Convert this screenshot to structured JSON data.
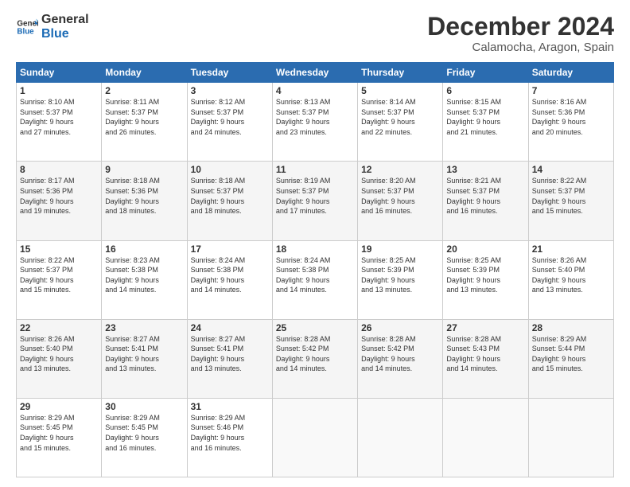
{
  "logo": {
    "line1": "General",
    "line2": "Blue"
  },
  "title": "December 2024",
  "location": "Calamocha, Aragon, Spain",
  "days_header": [
    "Sunday",
    "Monday",
    "Tuesday",
    "Wednesday",
    "Thursday",
    "Friday",
    "Saturday"
  ],
  "weeks": [
    [
      {
        "num": "1",
        "rise": "8:10 AM",
        "set": "5:37 PM",
        "hours": "9",
        "mins": "27"
      },
      {
        "num": "2",
        "rise": "8:11 AM",
        "set": "5:37 PM",
        "hours": "9",
        "mins": "26"
      },
      {
        "num": "3",
        "rise": "8:12 AM",
        "set": "5:37 PM",
        "hours": "9",
        "mins": "24"
      },
      {
        "num": "4",
        "rise": "8:13 AM",
        "set": "5:37 PM",
        "hours": "9",
        "mins": "23"
      },
      {
        "num": "5",
        "rise": "8:14 AM",
        "set": "5:37 PM",
        "hours": "9",
        "mins": "22"
      },
      {
        "num": "6",
        "rise": "8:15 AM",
        "set": "5:37 PM",
        "hours": "9",
        "mins": "21"
      },
      {
        "num": "7",
        "rise": "8:16 AM",
        "set": "5:36 PM",
        "hours": "9",
        "mins": "20"
      }
    ],
    [
      {
        "num": "8",
        "rise": "8:17 AM",
        "set": "5:36 PM",
        "hours": "9",
        "mins": "19"
      },
      {
        "num": "9",
        "rise": "8:18 AM",
        "set": "5:36 PM",
        "hours": "9",
        "mins": "18"
      },
      {
        "num": "10",
        "rise": "8:18 AM",
        "set": "5:37 PM",
        "hours": "9",
        "mins": "18"
      },
      {
        "num": "11",
        "rise": "8:19 AM",
        "set": "5:37 PM",
        "hours": "9",
        "mins": "17"
      },
      {
        "num": "12",
        "rise": "8:20 AM",
        "set": "5:37 PM",
        "hours": "9",
        "mins": "16"
      },
      {
        "num": "13",
        "rise": "8:21 AM",
        "set": "5:37 PM",
        "hours": "9",
        "mins": "16"
      },
      {
        "num": "14",
        "rise": "8:22 AM",
        "set": "5:37 PM",
        "hours": "9",
        "mins": "15"
      }
    ],
    [
      {
        "num": "15",
        "rise": "8:22 AM",
        "set": "5:37 PM",
        "hours": "9",
        "mins": "15"
      },
      {
        "num": "16",
        "rise": "8:23 AM",
        "set": "5:38 PM",
        "hours": "9",
        "mins": "14"
      },
      {
        "num": "17",
        "rise": "8:24 AM",
        "set": "5:38 PM",
        "hours": "9",
        "mins": "14"
      },
      {
        "num": "18",
        "rise": "8:24 AM",
        "set": "5:38 PM",
        "hours": "9",
        "mins": "14"
      },
      {
        "num": "19",
        "rise": "8:25 AM",
        "set": "5:39 PM",
        "hours": "9",
        "mins": "13"
      },
      {
        "num": "20",
        "rise": "8:25 AM",
        "set": "5:39 PM",
        "hours": "9",
        "mins": "13"
      },
      {
        "num": "21",
        "rise": "8:26 AM",
        "set": "5:40 PM",
        "hours": "9",
        "mins": "13"
      }
    ],
    [
      {
        "num": "22",
        "rise": "8:26 AM",
        "set": "5:40 PM",
        "hours": "9",
        "mins": "13"
      },
      {
        "num": "23",
        "rise": "8:27 AM",
        "set": "5:41 PM",
        "hours": "9",
        "mins": "13"
      },
      {
        "num": "24",
        "rise": "8:27 AM",
        "set": "5:41 PM",
        "hours": "9",
        "mins": "13"
      },
      {
        "num": "25",
        "rise": "8:28 AM",
        "set": "5:42 PM",
        "hours": "9",
        "mins": "14"
      },
      {
        "num": "26",
        "rise": "8:28 AM",
        "set": "5:42 PM",
        "hours": "9",
        "mins": "14"
      },
      {
        "num": "27",
        "rise": "8:28 AM",
        "set": "5:43 PM",
        "hours": "9",
        "mins": "14"
      },
      {
        "num": "28",
        "rise": "8:29 AM",
        "set": "5:44 PM",
        "hours": "9",
        "mins": "15"
      }
    ],
    [
      {
        "num": "29",
        "rise": "8:29 AM",
        "set": "5:45 PM",
        "hours": "9",
        "mins": "15"
      },
      {
        "num": "30",
        "rise": "8:29 AM",
        "set": "5:45 PM",
        "hours": "9",
        "mins": "16"
      },
      {
        "num": "31",
        "rise": "8:29 AM",
        "set": "5:46 PM",
        "hours": "9",
        "mins": "16"
      },
      null,
      null,
      null,
      null
    ]
  ]
}
